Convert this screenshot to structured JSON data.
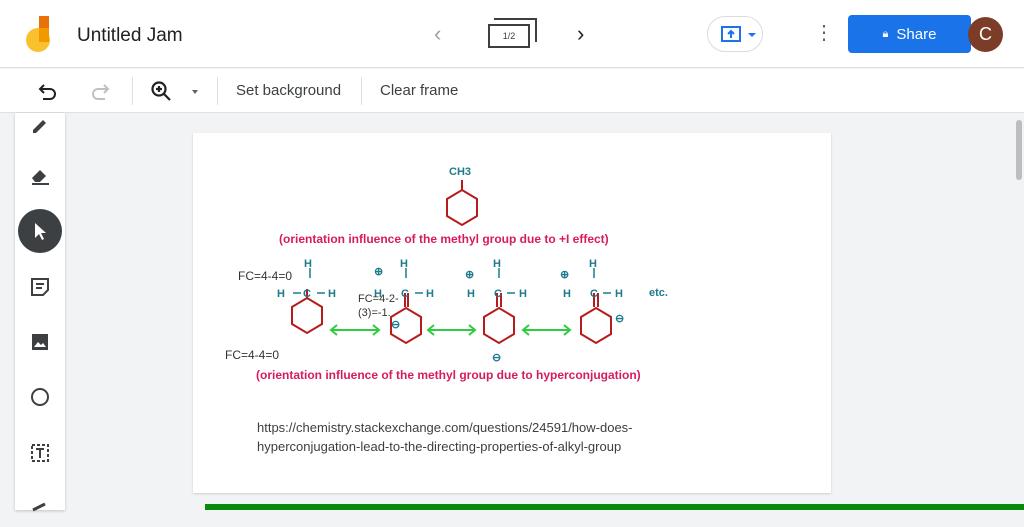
{
  "app": {
    "title": "Untitled Jam",
    "frame_indicator": "1/2",
    "share_label": "Share",
    "avatar_initial": "C"
  },
  "toolbar": {
    "set_background": "Set background",
    "clear_frame": "Clear frame"
  },
  "content": {
    "ch3": "CH3",
    "caption1": "(orientation influence of the methyl group due to +I  effect)",
    "caption2": "(orientation influence of the methyl group due to hyperconjugation)",
    "fc_top": "FC=4-4=0",
    "fc_bottom": "FC=4-4=0",
    "fc_mid_1": "FC=4-2-",
    "fc_mid_2": "(3)=-1.",
    "h": "H",
    "c": "C",
    "etc": "etc.",
    "plus": "⊕",
    "minus": "⊖",
    "url": "https://chemistry.stackexchange.com/questions/24591/how-does-hyperconjugation-lead-to-the-directing-properties-of-alkyl-group"
  },
  "colors": {
    "accent": "#1a73e8",
    "ring": "#b71c1c",
    "caption": "#d81b60",
    "atom": "#1e7a8c",
    "arrow": "#2ecc40",
    "progress": "#0a8a0a"
  }
}
